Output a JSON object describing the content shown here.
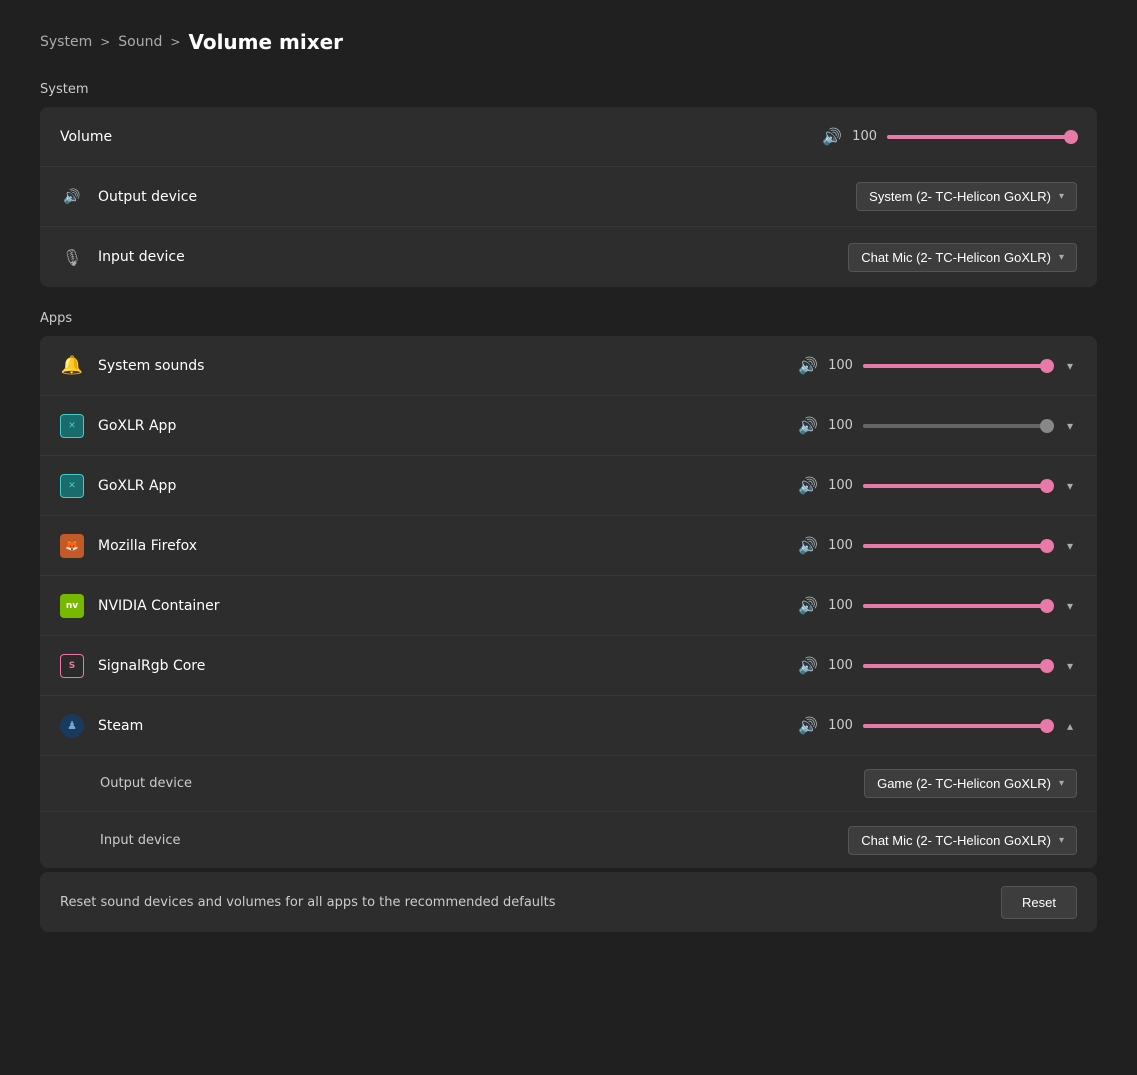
{
  "breadcrumb": {
    "system_label": "System",
    "sound_label": "Sound",
    "current_label": "Volume mixer",
    "sep1": ">",
    "sep2": ">"
  },
  "system_section": {
    "label": "System",
    "volume_row": {
      "label": "Volume",
      "value": "100",
      "fill_pct": 100
    },
    "output_device_row": {
      "label": "Output device",
      "dropdown_value": "System (2- TC-Helicon GoXLR)"
    },
    "input_device_row": {
      "label": "Input device",
      "dropdown_value": "Chat Mic (2- TC-Helicon GoXLR)"
    }
  },
  "apps_section": {
    "label": "Apps",
    "apps": [
      {
        "id": "system-sounds",
        "name": "System sounds",
        "icon_type": "system",
        "volume": "100",
        "fill_pct": 100,
        "fill_color": "pink",
        "expanded": false
      },
      {
        "id": "goxlr-app-1",
        "name": "GoXLR App",
        "icon_type": "goxlr",
        "volume": "100",
        "fill_pct": 100,
        "fill_color": "gray",
        "expanded": false
      },
      {
        "id": "goxlr-app-2",
        "name": "GoXLR App",
        "icon_type": "goxlr",
        "volume": "100",
        "fill_pct": 100,
        "fill_color": "pink",
        "expanded": false
      },
      {
        "id": "mozilla-firefox",
        "name": "Mozilla Firefox",
        "icon_type": "firefox",
        "volume": "100",
        "fill_pct": 100,
        "fill_color": "pink",
        "expanded": false
      },
      {
        "id": "nvidia-container",
        "name": "NVIDIA Container",
        "icon_type": "nvidia",
        "volume": "100",
        "fill_pct": 100,
        "fill_color": "pink",
        "expanded": false
      },
      {
        "id": "signalrgb-core",
        "name": "SignalRgb Core",
        "icon_type": "signal",
        "volume": "100",
        "fill_pct": 100,
        "fill_color": "pink",
        "expanded": false
      },
      {
        "id": "steam",
        "name": "Steam",
        "icon_type": "steam",
        "volume": "100",
        "fill_pct": 100,
        "fill_color": "pink",
        "expanded": true,
        "output_device": "Game (2- TC-Helicon GoXLR)",
        "input_device": "Chat Mic (2- TC-Helicon GoXLR)"
      }
    ]
  },
  "footer": {
    "text": "Reset sound devices and volumes for all apps to the recommended defaults",
    "reset_label": "Reset"
  }
}
